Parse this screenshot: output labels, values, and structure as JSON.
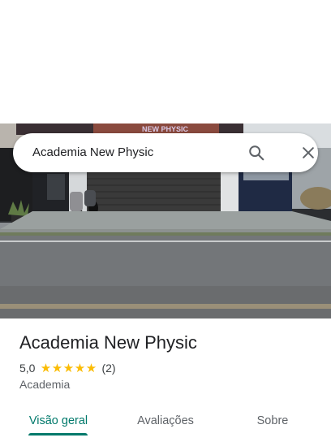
{
  "search": {
    "query": "Academia New Physic",
    "search_icon": "search-icon",
    "close_icon": "close-icon"
  },
  "place": {
    "name": "Academia New Physic",
    "rating": "5,0",
    "stars": 5,
    "reviews": "(2)",
    "category": "Academia",
    "star_color": "#fbbc04"
  },
  "photo": {
    "sign_text": "NEW PHYSIC"
  },
  "tabs": [
    {
      "label": "Visão geral",
      "active": true
    },
    {
      "label": "Avaliações",
      "active": false
    },
    {
      "label": "Sobre",
      "active": false
    }
  ],
  "colors": {
    "accent": "#00796b",
    "text_primary": "#202124",
    "text_secondary": "#5f6368"
  }
}
